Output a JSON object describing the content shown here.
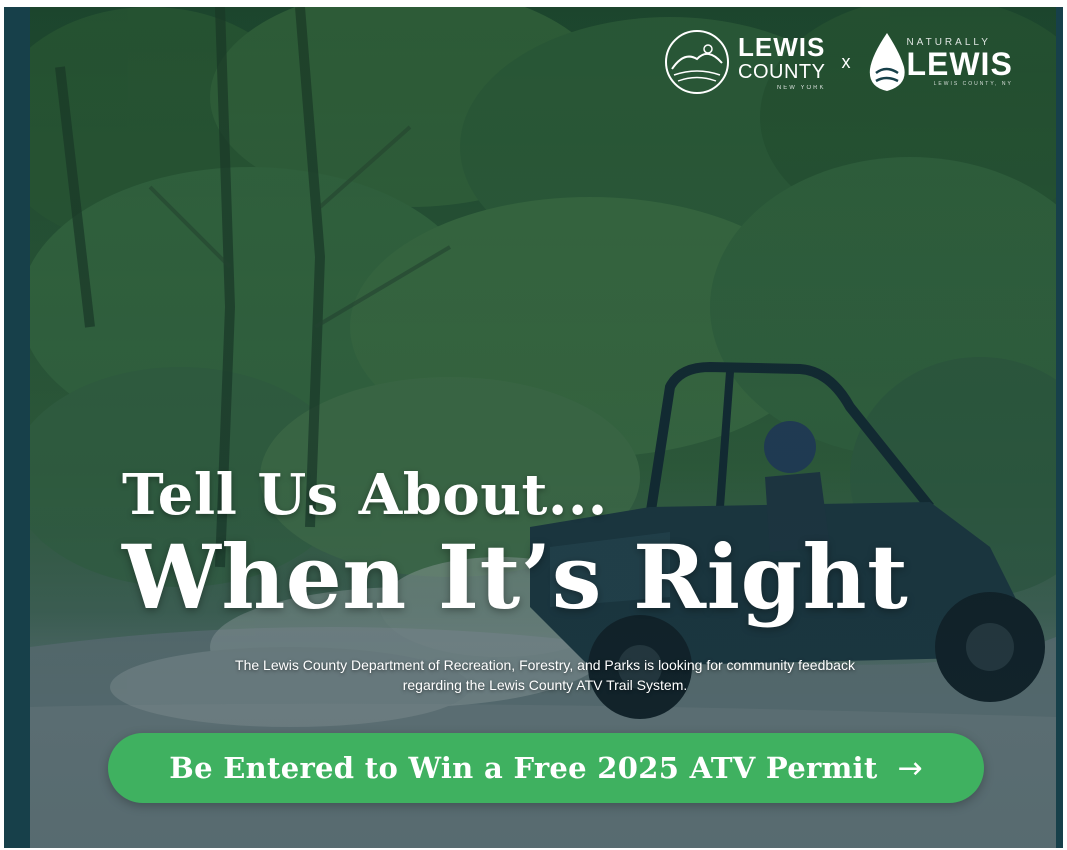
{
  "branding": {
    "county_line1": "LEWIS",
    "county_line2": "COUNTY",
    "county_line3": "NEW YORK",
    "separator": "x",
    "partner_line1": "NATURALLY",
    "partner_line2": "LEWIS",
    "partner_line3": "LEWIS COUNTY, NY"
  },
  "hero": {
    "headline_line1": "Tell Us About...",
    "headline_line2": "When It’s Right",
    "body_line1": "The Lewis County Department of Recreation, Forestry, and Parks is looking for community feedback",
    "body_line2": "regarding the Lewis County ATV Trail System."
  },
  "cta": {
    "label": "Be Entered to Win a Free 2025 ATV Permit",
    "arrow": "→"
  },
  "colors": {
    "frame_border": "#17404a",
    "cta_background": "#3fb160",
    "text": "#ffffff"
  }
}
